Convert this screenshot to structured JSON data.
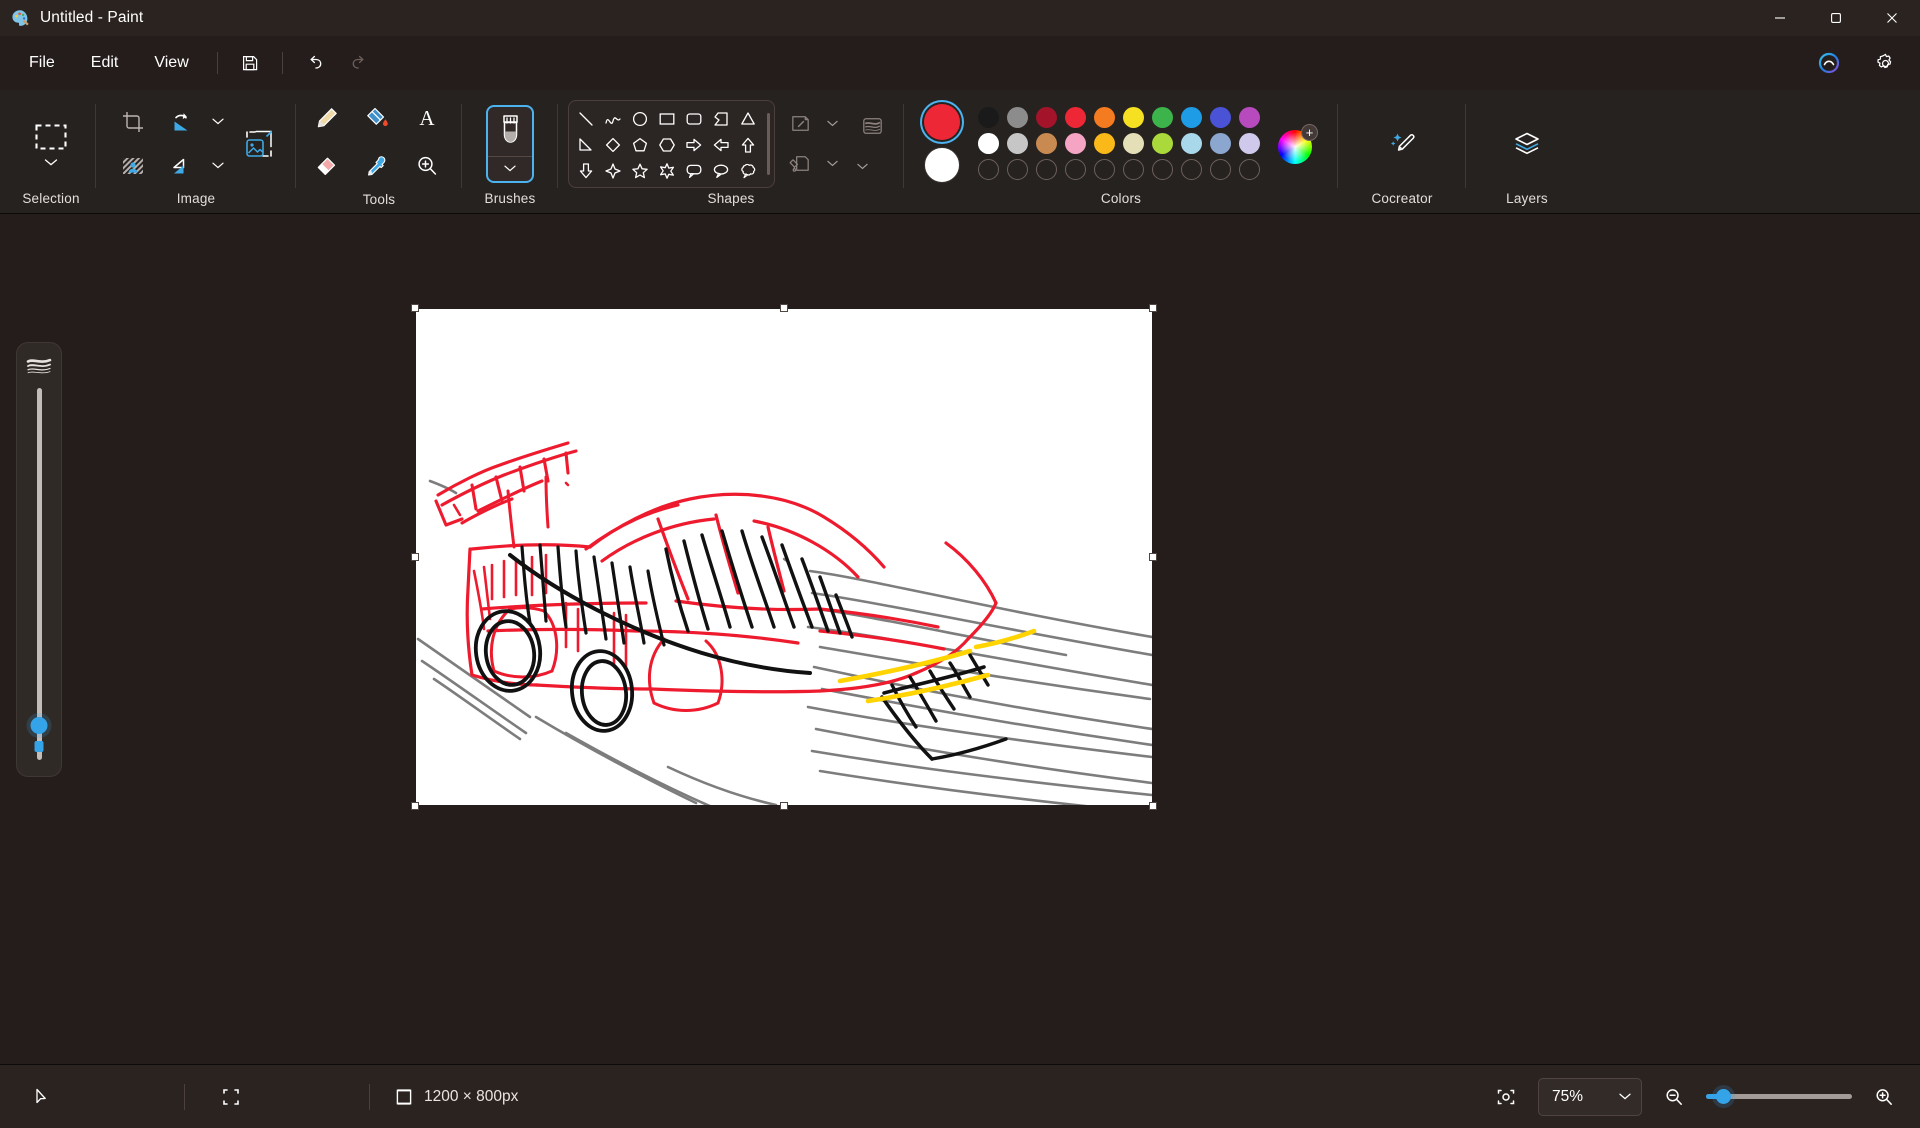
{
  "window": {
    "title": "Untitled - Paint",
    "app_icon": "paint-palette-icon",
    "minimize_label": "Minimize",
    "maximize_label": "Maximize",
    "close_label": "Close"
  },
  "menubar": {
    "items": [
      {
        "label": "File",
        "name": "menu-file"
      },
      {
        "label": "Edit",
        "name": "menu-edit"
      },
      {
        "label": "View",
        "name": "menu-view"
      }
    ],
    "save_label": "Save",
    "undo_label": "Undo",
    "redo_label": "Redo",
    "copilot_label": "Copilot",
    "settings_label": "Settings"
  },
  "ribbon": {
    "groups": [
      {
        "label": "Selection"
      },
      {
        "label": "Image"
      },
      {
        "label": "Tools"
      },
      {
        "label": "Brushes"
      },
      {
        "label": "Shapes"
      },
      {
        "label": "Colors"
      },
      {
        "label": "Cocreator"
      },
      {
        "label": "Layers"
      }
    ],
    "selection": {
      "label": "Selection",
      "tool": "rectangular-selection"
    },
    "image": {
      "label": "Image",
      "tools": [
        "crop",
        "rotate",
        "resize-skew",
        "flip",
        "background-removal"
      ]
    },
    "tools": {
      "label": "Tools",
      "items": [
        {
          "name": "pencil-tool",
          "title": "Pencil"
        },
        {
          "name": "fill-tool",
          "title": "Fill with color"
        },
        {
          "name": "text-tool",
          "title": "Text"
        },
        {
          "name": "eraser-tool",
          "title": "Eraser"
        },
        {
          "name": "color-picker-tool",
          "title": "Color picker"
        },
        {
          "name": "magnifier-tool",
          "title": "Magnifier"
        }
      ]
    },
    "brushes": {
      "label": "Brushes",
      "selected": true,
      "current": "marker-brush"
    },
    "shapes": {
      "label": "Shapes",
      "items": [
        "line",
        "curve",
        "oval",
        "rectangle",
        "rounded-rectangle",
        "polygon",
        "triangle",
        "right-triangle",
        "diamond",
        "pentagon",
        "hexagon",
        "right-arrow",
        "left-arrow",
        "up-arrow",
        "down-arrow",
        "four-point-star",
        "five-point-star",
        "six-point-star",
        "rectangular-callout",
        "oval-callout",
        "cloud-callout"
      ],
      "outline_label": "Outline",
      "fill_label": "Fill",
      "thickness_label": "Size"
    },
    "colors": {
      "label": "Colors",
      "primary": "#ee2737",
      "secondary": "#ffffff",
      "row1": [
        "#1a1a1a",
        "#8c8c8c",
        "#a3142a",
        "#ee2737",
        "#f47b20",
        "#f5e021",
        "#3cb44b",
        "#1f9ce6",
        "#4a53d6",
        "#b74bbd"
      ],
      "row2": [
        "#ffffff",
        "#c6c6c6",
        "#c98a52",
        "#f6a4c3",
        "#fbb919",
        "#e5dfb8",
        "#a9d93a",
        "#a8d8ea",
        "#8ba6cf",
        "#cfc9ec"
      ],
      "row3": [
        "",
        "",
        "",
        "",
        "",
        "",
        "",
        "",
        "",
        ""
      ],
      "wheel_label": "Edit colors",
      "wheel_badge": "+"
    },
    "cocreator": {
      "label": "Cocreator"
    },
    "layers": {
      "label": "Layers"
    }
  },
  "brush_size": {
    "name": "brush-size-slider",
    "icon": "brush-thickness-icon",
    "value": 8
  },
  "canvas": {
    "background": "#ffffff",
    "drawing_description": "hand-drawn red sports car sketch with black hatching, yellow headlight strokes and gray motion lines",
    "selected": true
  },
  "statusbar": {
    "cursor_icon": "cursor-arrow-icon",
    "selection_icon": "selection-icon",
    "canvas_icon": "canvas-size-icon",
    "canvas_size": "1200 × 800px",
    "fit_label": "Fit to window",
    "zoom_value": "75%",
    "zoom_out_label": "Zoom out",
    "zoom_in_label": "Zoom in",
    "zoom_percent": 75
  }
}
